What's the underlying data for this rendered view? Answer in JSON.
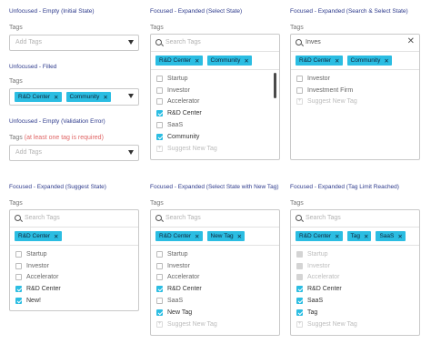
{
  "col1": {
    "s1": {
      "title": "Unfocused - Empty (Initial State)",
      "label": "Tags",
      "placeholder": "Add Tags"
    },
    "s2": {
      "title": "Unfocused - Filled",
      "label": "Tags",
      "tags": [
        "R&D Center",
        "Community"
      ]
    },
    "s3": {
      "title": "Unfocused - Empty (Validation Error)",
      "label": "Tags",
      "error": "(at least one tag is required)",
      "placeholder": "Add Tags"
    },
    "s4": {
      "title": "Focused - Expanded (Suggest State)",
      "label": "Tags",
      "search_placeholder": "Search Tags",
      "tags": [
        "R&D Center"
      ],
      "options": [
        "Startup",
        "Investor",
        "Accelerator",
        "R&D Center",
        "New!"
      ]
    }
  },
  "col2": {
    "s1": {
      "title": "Focused - Expanded (Select State)",
      "label": "Tags",
      "search_placeholder": "Search Tags",
      "tags": [
        "R&D Center",
        "Community"
      ],
      "options": [
        "Startup",
        "Investor",
        "Accelerator",
        "R&D Center",
        "SaaS",
        "Community",
        "Suggest New Tag"
      ]
    },
    "s2": {
      "title": "Focused - Expanded (Select State with New Tag)",
      "label": "Tags",
      "search_placeholder": "Search Tags",
      "tags": [
        "R&D Center",
        "New Tag"
      ],
      "options": [
        "Startup",
        "Investor",
        "Accelerator",
        "R&D Center",
        "SaaS",
        "New Tag",
        "Suggest New Tag"
      ]
    }
  },
  "col3": {
    "s1": {
      "title": "Focused - Expanded (Search & Select State)",
      "label": "Tags",
      "search_value": "Inves",
      "tags": [
        "R&D Center",
        "Community"
      ],
      "options": [
        "Investor",
        "Investment Firm",
        "Suggest New Tag"
      ]
    },
    "s2": {
      "title": "Focused - Expanded (Tag Limit Reached)",
      "label": "Tags",
      "search_placeholder": "Search Tags",
      "tags": [
        "R&D Center",
        "Tag",
        "SaaS"
      ],
      "options": [
        "Startup",
        "Investor",
        "Accelerator",
        "R&D Center",
        "SaaS",
        "Tag",
        "Suggest New Tag"
      ]
    }
  },
  "icons": {
    "search": "search-icon",
    "remove": "close-icon",
    "dropdown": "chevron-down-icon",
    "clear": "clear-icon"
  },
  "colors": {
    "accent": "#2bbde2",
    "title": "#2d3a8c",
    "error": "#e06565"
  }
}
